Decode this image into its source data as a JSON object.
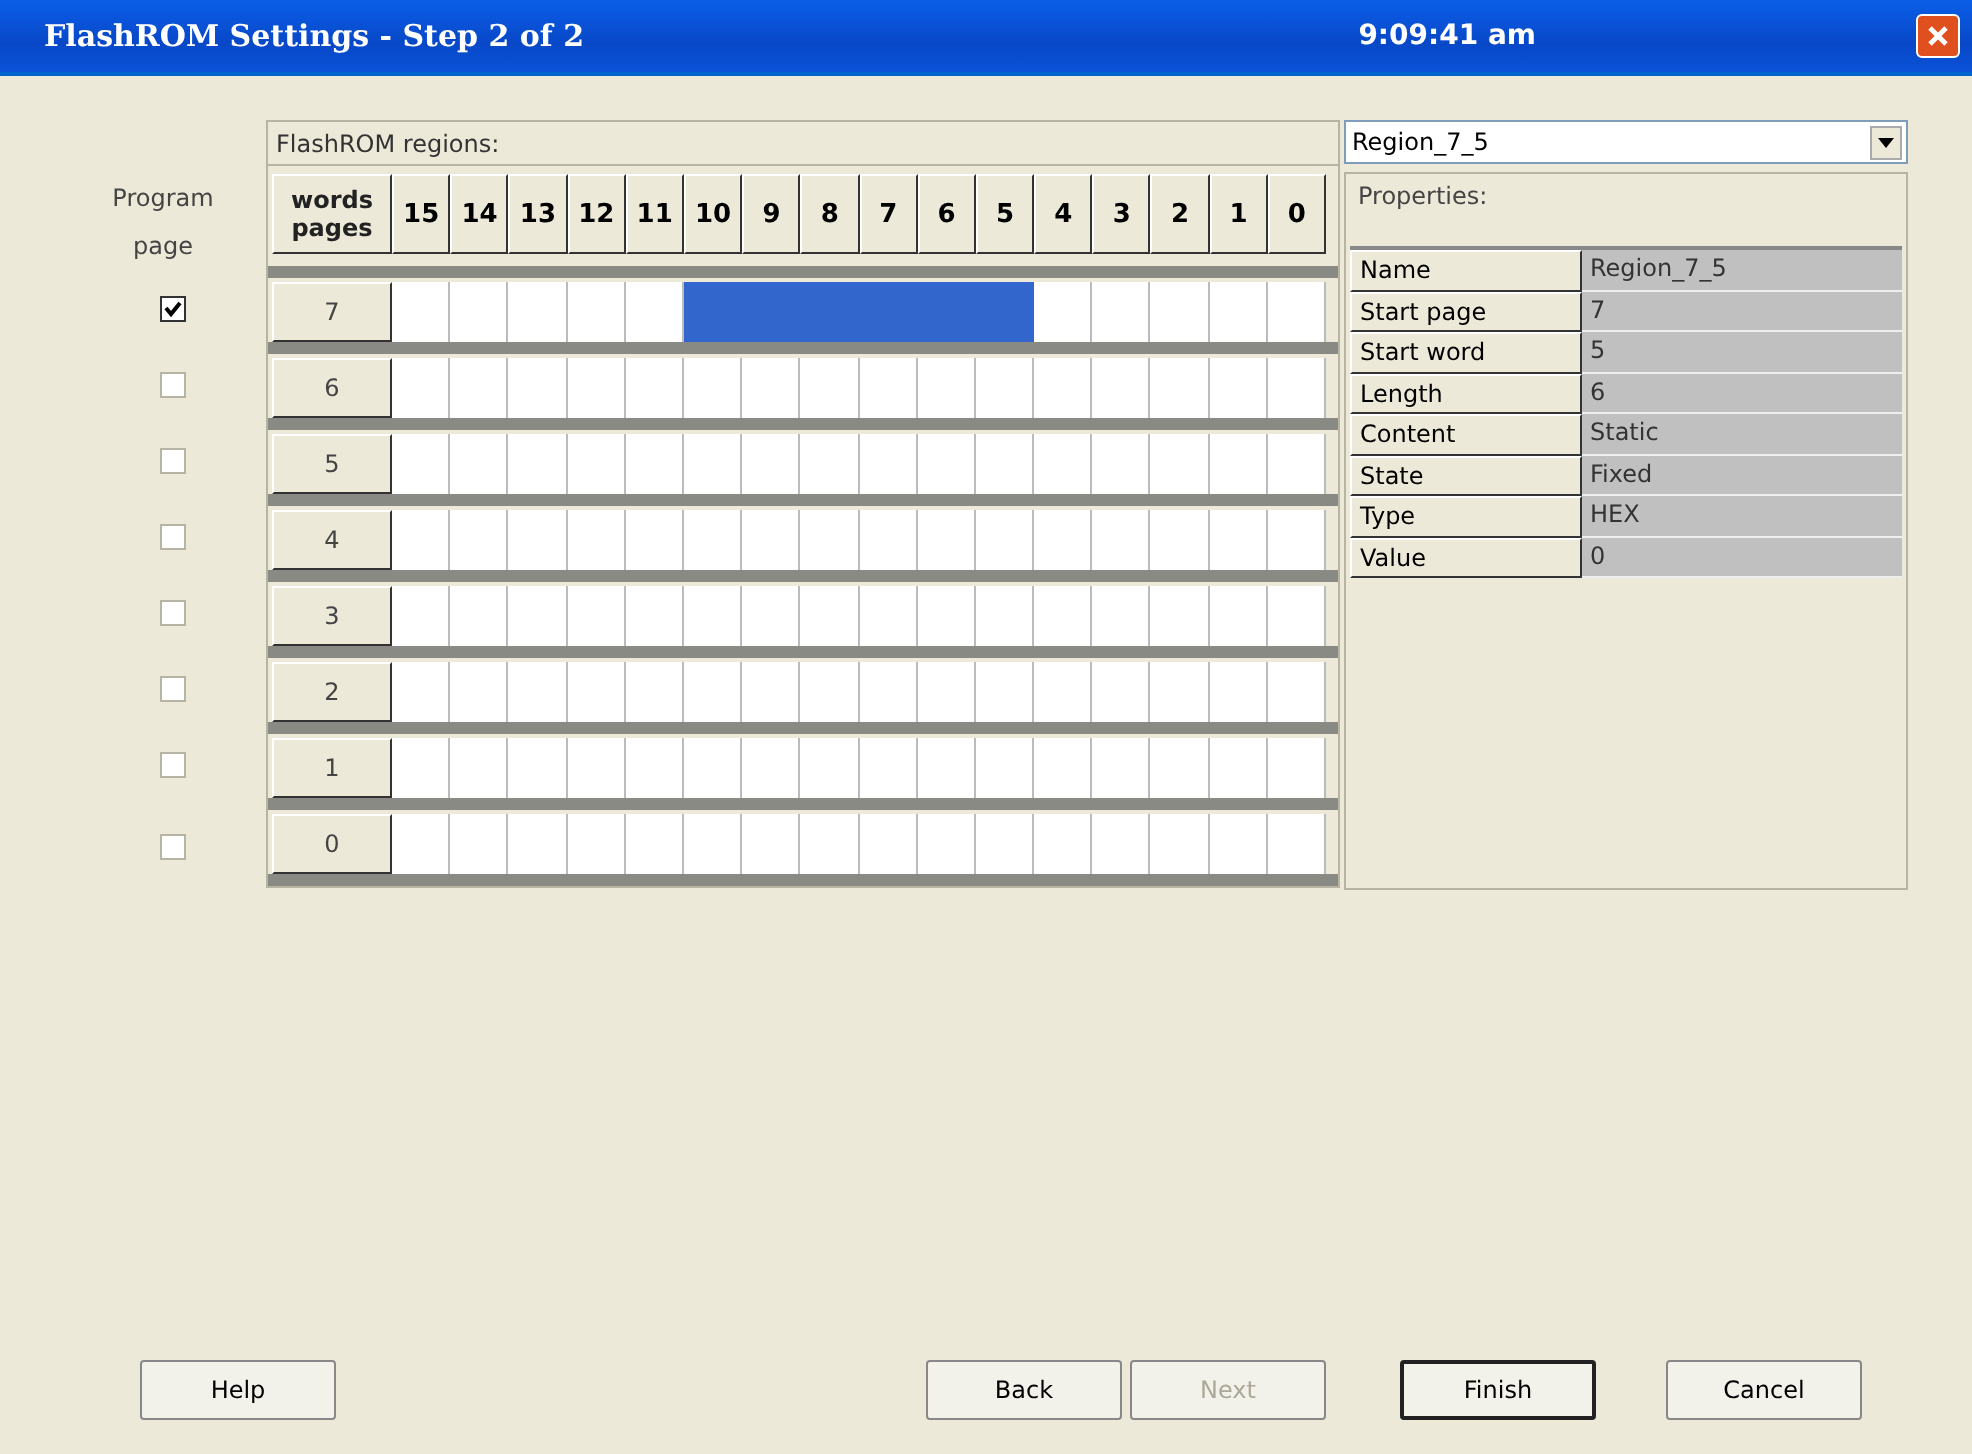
{
  "window": {
    "title": "FlashROM Settings - Step 2 of 2",
    "clock": "9:09:41 am"
  },
  "program_column": {
    "label_line_1": "Program",
    "label_line_2": "page"
  },
  "grid": {
    "title": "FlashROM regions:",
    "corner_top": "words",
    "corner_bottom": "pages",
    "columns": [
      "15",
      "14",
      "13",
      "12",
      "11",
      "10",
      "9",
      "8",
      "7",
      "6",
      "5",
      "4",
      "3",
      "2",
      "1",
      "0"
    ],
    "rows": [
      {
        "page": "7",
        "program": true,
        "cells": [
          false,
          false,
          false,
          false,
          false,
          true,
          true,
          true,
          true,
          true,
          true,
          false,
          false,
          false,
          false,
          false
        ]
      },
      {
        "page": "6",
        "program": false,
        "cells": [
          false,
          false,
          false,
          false,
          false,
          false,
          false,
          false,
          false,
          false,
          false,
          false,
          false,
          false,
          false,
          false
        ]
      },
      {
        "page": "5",
        "program": false,
        "cells": [
          false,
          false,
          false,
          false,
          false,
          false,
          false,
          false,
          false,
          false,
          false,
          false,
          false,
          false,
          false,
          false
        ]
      },
      {
        "page": "4",
        "program": false,
        "cells": [
          false,
          false,
          false,
          false,
          false,
          false,
          false,
          false,
          false,
          false,
          false,
          false,
          false,
          false,
          false,
          false
        ]
      },
      {
        "page": "3",
        "program": false,
        "cells": [
          false,
          false,
          false,
          false,
          false,
          false,
          false,
          false,
          false,
          false,
          false,
          false,
          false,
          false,
          false,
          false
        ]
      },
      {
        "page": "2",
        "program": false,
        "cells": [
          false,
          false,
          false,
          false,
          false,
          false,
          false,
          false,
          false,
          false,
          false,
          false,
          false,
          false,
          false,
          false
        ]
      },
      {
        "page": "1",
        "program": false,
        "cells": [
          false,
          false,
          false,
          false,
          false,
          false,
          false,
          false,
          false,
          false,
          false,
          false,
          false,
          false,
          false,
          false
        ]
      },
      {
        "page": "0",
        "program": false,
        "cells": [
          false,
          false,
          false,
          false,
          false,
          false,
          false,
          false,
          false,
          false,
          false,
          false,
          false,
          false,
          false,
          false
        ]
      }
    ]
  },
  "region_select": {
    "value": "Region_7_5"
  },
  "properties": {
    "title": "Properties:",
    "rows": [
      {
        "name": "Name",
        "value": "Region_7_5"
      },
      {
        "name": "Start page",
        "value": "7"
      },
      {
        "name": "Start word",
        "value": "5"
      },
      {
        "name": "Length",
        "value": "6"
      },
      {
        "name": "Content",
        "value": "Static"
      },
      {
        "name": "State",
        "value": "Fixed"
      },
      {
        "name": "Type",
        "value": "HEX"
      },
      {
        "name": "Value",
        "value": "0"
      }
    ]
  },
  "buttons": [
    {
      "label": "Help",
      "disabled": false,
      "default": false
    },
    {
      "label": "Back",
      "disabled": false,
      "default": false
    },
    {
      "label": "Next",
      "disabled": true,
      "default": false
    },
    {
      "label": "Finish",
      "disabled": false,
      "default": true
    },
    {
      "label": "Cancel",
      "disabled": false,
      "default": false
    }
  ]
}
